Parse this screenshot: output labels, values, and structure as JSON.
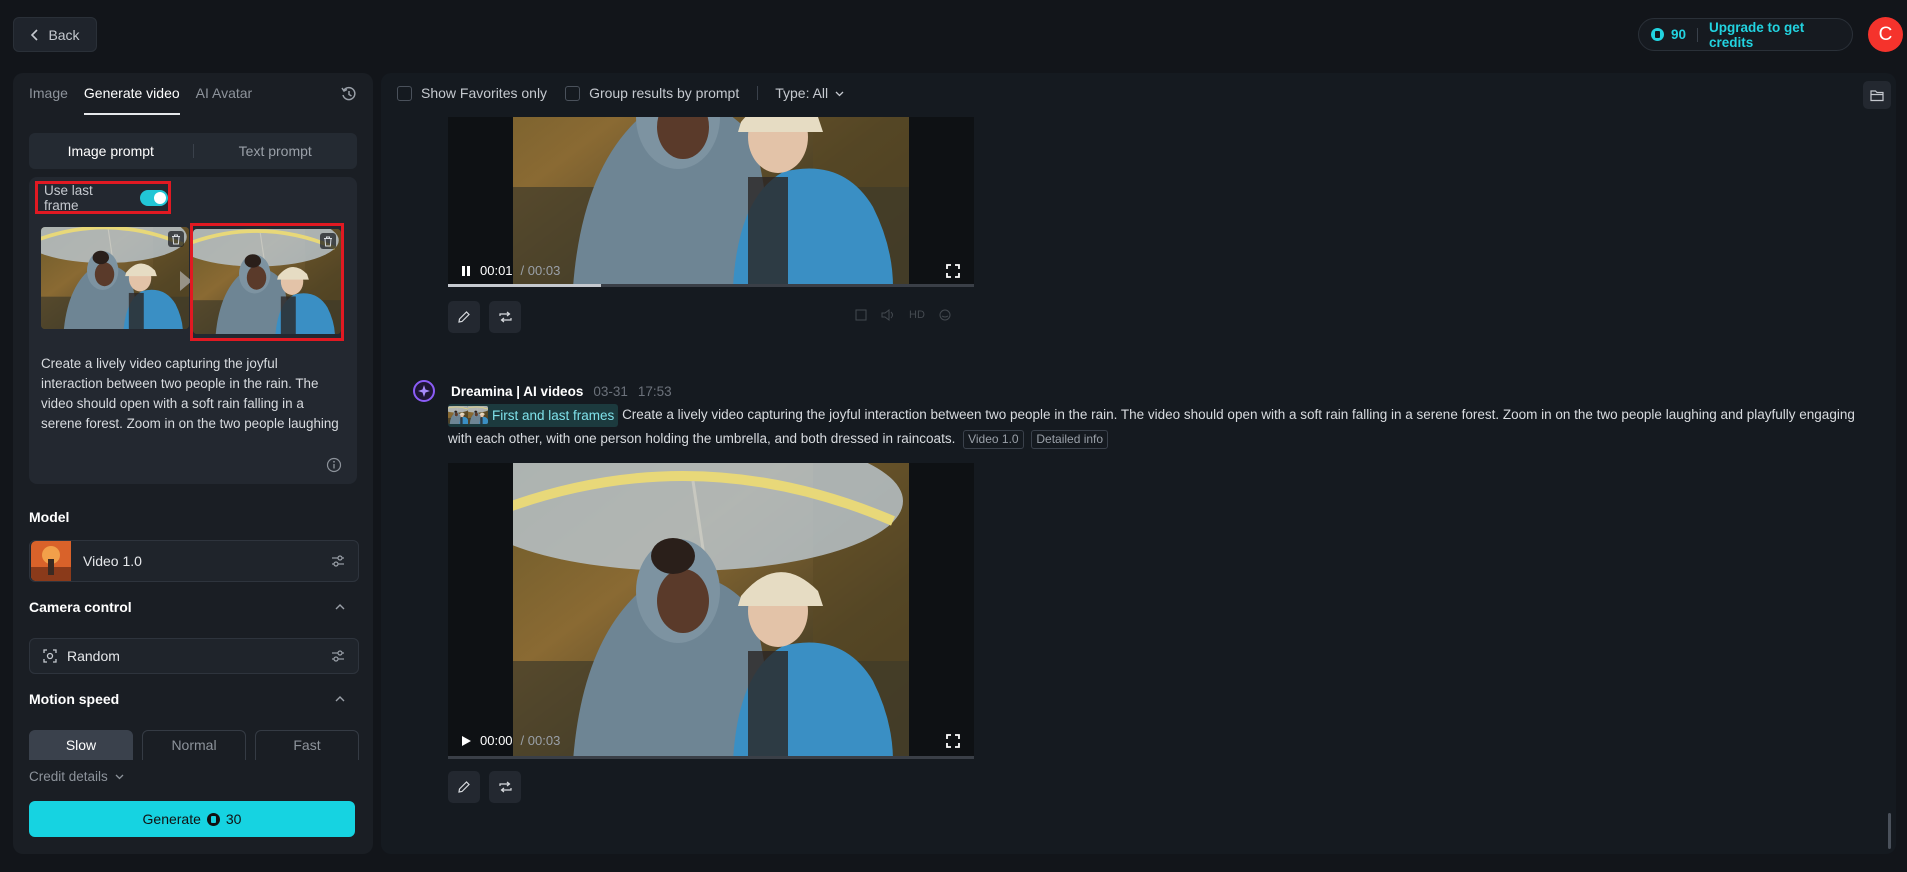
{
  "topbar": {
    "back_label": "Back",
    "credits": "90",
    "upgrade_label": "Upgrade to get credits",
    "avatar_initial": "C"
  },
  "left_panel": {
    "tabs": [
      {
        "label": "Image"
      },
      {
        "label": "Generate video",
        "active": true
      },
      {
        "label": "AI Avatar"
      }
    ],
    "prompt_modes": {
      "image": "Image prompt",
      "text": "Text prompt",
      "selected": "Image prompt"
    },
    "use_last_frame": {
      "label": "Use last frame",
      "enabled": true
    },
    "prompt_text": "Create a lively video capturing the joyful interaction between two people in the rain. The video should open with a soft rain falling in a serene forest. Zoom in on the two people laughing and playfully engaging with each other",
    "model": {
      "section_label": "Model",
      "value": "Video 1.0"
    },
    "camera": {
      "section_label": "Camera control",
      "value": "Random"
    },
    "motion": {
      "section_label": "Motion speed",
      "options": [
        "Slow",
        "Normal",
        "Fast"
      ],
      "selected": "Slow"
    },
    "credit_details_label": "Credit details",
    "generate": {
      "label": "Generate",
      "cost": "30"
    }
  },
  "right_panel": {
    "filters": {
      "favorites_label": "Show Favorites only",
      "group_label": "Group results by prompt",
      "type_label": "Type: All"
    },
    "video1": {
      "time": "00:01",
      "duration": "/ 00:03",
      "progress": 0.29,
      "playing": true
    },
    "entry": {
      "author": "Dreamina | AI videos",
      "date": "03-31",
      "time": "17:53",
      "chip_label": "First and last frames",
      "prompt": "Create a lively video capturing the joyful interaction between two people in the rain. The video should open with a soft rain falling in a serene forest. Zoom in on the two people laughing and playfully engaging with each other, with one person holding the umbrella, and both dressed in raincoats.",
      "model_tag": "Video 1.0",
      "info_tag": "Detailed info"
    },
    "video2": {
      "time": "00:00",
      "duration": "/ 00:03",
      "progress": 0,
      "playing": false
    },
    "faint_icons": [
      "frame-icon",
      "audio-icon",
      "HD",
      "lipsync-icon"
    ]
  },
  "colors": {
    "accent": "#16d3e1",
    "highlight_border": "#e11922",
    "avatar": "#f5332c",
    "brand_purple": "#8b5cf6"
  }
}
